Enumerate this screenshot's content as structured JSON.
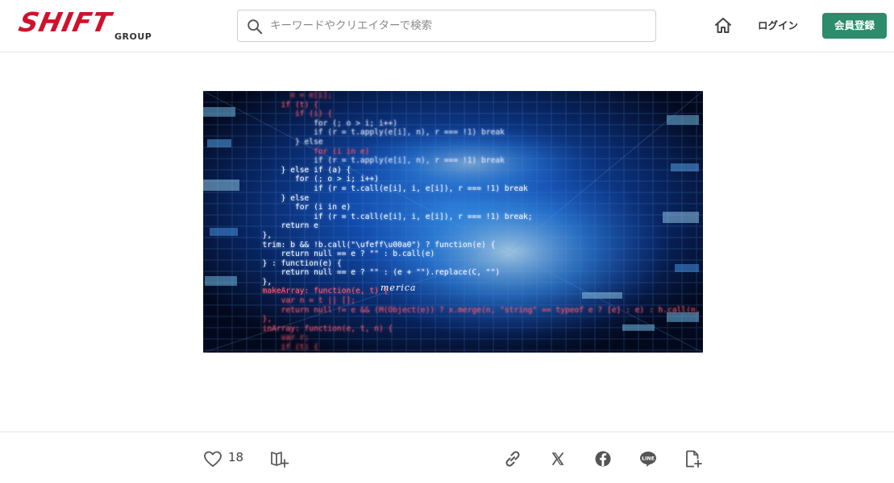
{
  "header": {
    "logo_text": "SHIFT",
    "logo_subtext": "GROUP",
    "search_placeholder": "キーワードやクリエイターで検索",
    "login_label": "ログイン",
    "signup_label": "会員登録"
  },
  "hero": {
    "signature": "merica",
    "code_lines": [
      {
        "text": "        e = e[i];",
        "style": "red blur2"
      },
      {
        "text": "      if (t) {",
        "style": "red blur"
      },
      {
        "text": "         if (i) {",
        "style": "red blur"
      },
      {
        "text": "             for (; o > i; i++)",
        "style": "blur"
      },
      {
        "text": "             if (r = t.apply(e[i], n), r === !1) break",
        "style": "blur"
      },
      {
        "text": "         } else",
        "style": "blur"
      },
      {
        "text": "             for (i in e)",
        "style": "red blur"
      },
      {
        "text": "             if (r = t.apply(e[i], n), r === !1) break",
        "style": "blur"
      },
      {
        "text": "      } else if (a) {",
        "style": ""
      },
      {
        "text": "         for (; o > i; i++)",
        "style": ""
      },
      {
        "text": "             if (r = t.call(e[i], i, e[i]), r === !1) break",
        "style": ""
      },
      {
        "text": "      } else",
        "style": ""
      },
      {
        "text": "         for (i in e)",
        "style": ""
      },
      {
        "text": "             if (r = t.call(e[i], i, e[i]), r === !1) break;",
        "style": ""
      },
      {
        "text": "      return e",
        "style": ""
      },
      {
        "text": "  },",
        "style": ""
      },
      {
        "text": "  trim: b && !b.call(\"\\ufeff\\u00a0\") ? function(e) {",
        "style": ""
      },
      {
        "text": "      return null == e ? \"\" : b.call(e)",
        "style": ""
      },
      {
        "text": "  } : function(e) {",
        "style": ""
      },
      {
        "text": "      return null == e ? \"\" : (e + \"\").replace(C, \"\")",
        "style": ""
      },
      {
        "text": "  },",
        "style": ""
      },
      {
        "text": "  makeArray: function(e, t) {",
        "style": "red"
      },
      {
        "text": "      var n = t || [];",
        "style": "red blur"
      },
      {
        "text": "      return null != e && (M(Object(e)) ? x.merge(n, \"string\" == typeof e ? [e] : e) : h.call(n, e)), n",
        "style": "red blur"
      },
      {
        "text": "  },",
        "style": "red blur"
      },
      {
        "text": "  inArray: function(e, t, n) {",
        "style": "red blur"
      },
      {
        "text": "      var r;",
        "style": "red blur2"
      },
      {
        "text": "      if (t) {",
        "style": "red blur2"
      }
    ]
  }
}
